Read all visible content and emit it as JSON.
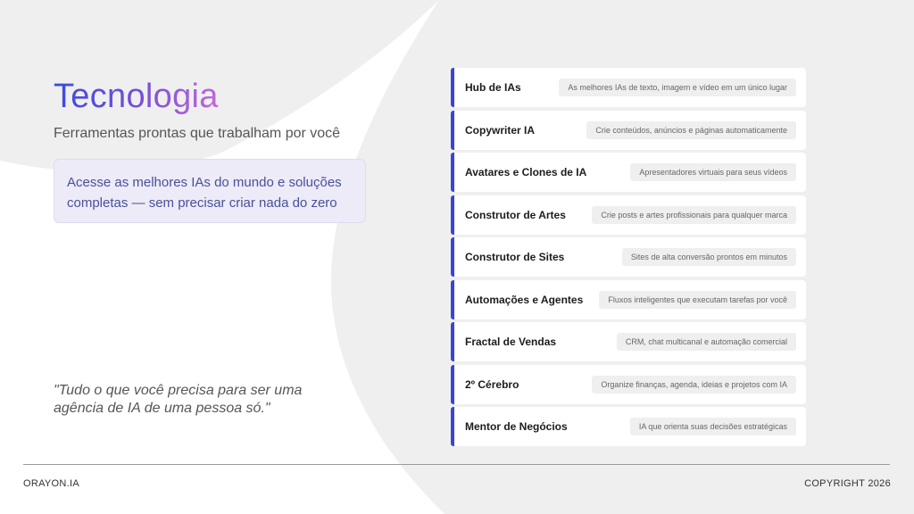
{
  "header": {
    "title": "Tecnologia",
    "subtitle": "Ferramentas prontas que trabalham por você"
  },
  "callout": {
    "line1": "Acesse as melhores IAs do mundo e soluções",
    "line2": "completas — sem precisar criar nada do zero"
  },
  "quote": {
    "line1": "\"Tudo o que você precisa para ser uma",
    "line2": "agência de IA de uma pessoa só.\""
  },
  "tools": [
    {
      "title": "Hub de IAs",
      "description": "As melhores IAs de texto, imagem e vídeo em um único lugar"
    },
    {
      "title": "Copywriter IA",
      "description": "Crie conteúdos, anúncios e páginas automaticamente"
    },
    {
      "title": "Avatares e Clones de IA",
      "description": "Apresentadores virtuais para seus vídeos"
    },
    {
      "title": "Construtor de Artes",
      "description": "Crie posts e artes profissionais para qualquer marca"
    },
    {
      "title": "Construtor de Sites",
      "description": "Sites de alta conversão prontos em minutos"
    },
    {
      "title": "Automações e Agentes",
      "description": "Fluxos inteligentes que executam tarefas por você"
    },
    {
      "title": "Fractal de Vendas",
      "description": "CRM, chat multicanal e automação comercial"
    },
    {
      "title": "2º Cérebro",
      "description": "Organize finanças, agenda, ideias e projetos com IA"
    },
    {
      "title": "Mentor de Negócios",
      "description": "IA que orienta suas decisões estratégicas"
    }
  ],
  "footer": {
    "brand": "ORAYON.IA",
    "copyright": "COPYRIGHT 2026"
  },
  "colors": {
    "accent": "#3a44d6",
    "title_gradient_start": "#3b4bdc",
    "title_gradient_end": "#c06ad8",
    "background": "#efefef"
  }
}
